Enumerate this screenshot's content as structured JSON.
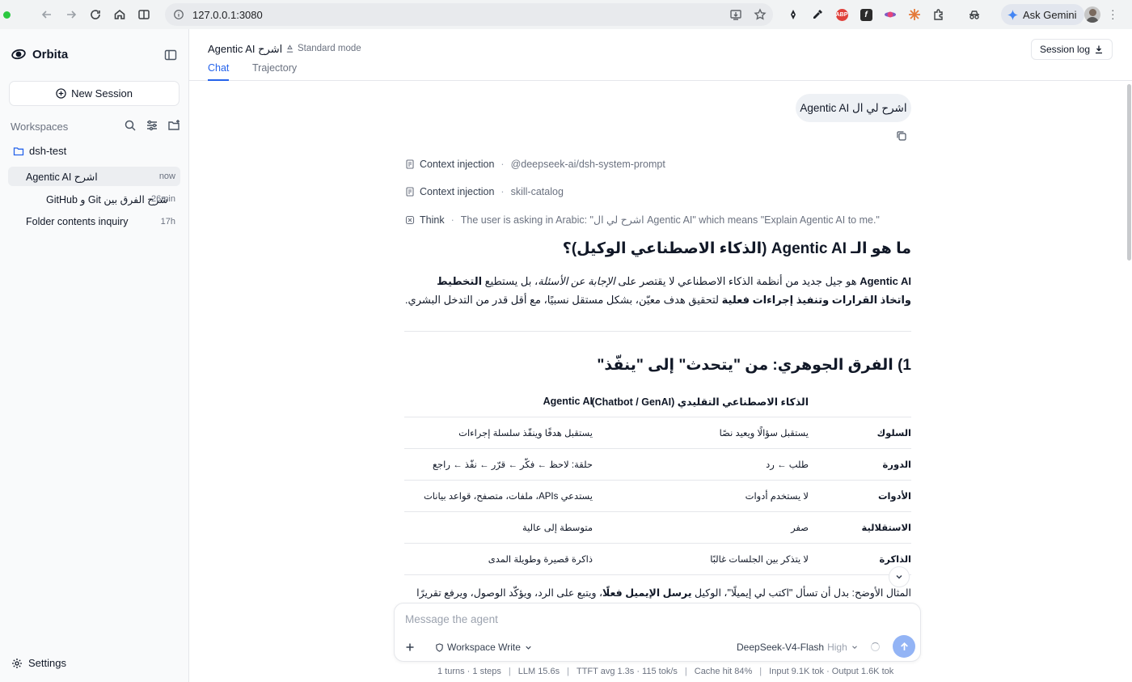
{
  "browser": {
    "url": "127.0.0.1:3080",
    "gemini_label": "Ask Gemini",
    "extensions": [
      "pen-icon",
      "eyedropper-icon",
      "adblock-icon",
      "font-icon",
      "planet-icon",
      "sparkle-icon",
      "puzzle-icon",
      "incognito-icon"
    ]
  },
  "sidebar": {
    "brand": "Orbita",
    "new_session": "New Session",
    "workspaces_title": "Workspaces",
    "folder": "dsh-test",
    "sessions": [
      {
        "title": "اشرح Agentic AI",
        "time": "now",
        "active": true
      },
      {
        "title": "شرح الفرق بين Git و GitHub",
        "time": "26min",
        "active": false
      },
      {
        "title": "Folder contents inquiry",
        "time": "17h",
        "active": false
      }
    ],
    "settings": "Settings"
  },
  "header": {
    "title": "اشرح Agentic AI",
    "mode": "Standard mode",
    "tabs": [
      {
        "label": "Chat",
        "active": true
      },
      {
        "label": "Trajectory",
        "active": false
      }
    ],
    "session_log": "Session log"
  },
  "chat": {
    "user_message": "اشرح لي ال Agentic AI",
    "steps": [
      {
        "kind": "Context injection",
        "detail": "@deepseek-ai/dsh-system-prompt"
      },
      {
        "kind": "Context injection",
        "detail": "skill-catalog"
      },
      {
        "kind": "Think",
        "detail": "The user is asking in Arabic: \"اشرح لي ال Agentic AI\" which means \"Explain Agentic AI to me.\""
      }
    ],
    "answer": {
      "heading1": "ما هو الـ Agentic AI (الذكاء الاصطناعي الوكيل)؟",
      "intro_term": "Agentic AI",
      "intro_a": " هو جيل جديد من أنظمة الذكاء الاصطناعي لا يقتصر على ",
      "intro_em": "الإجابة عن الأسئلة",
      "intro_b": "، بل يستطيع ",
      "intro_strong1": "التخطيط واتخاذ القرارات وتنفيذ إجراءات فعلية",
      "intro_c": " لتحقيق هدف معيّن، بشكل مستقل نسبيًا، مع أقل قدر من التدخل البشري.",
      "heading2": "1) الفرق الجوهري: من \"يتحدث\" إلى \"ينفّذ\"",
      "table_headers": [
        "",
        "الذكاء الاصطناعي التقليدي (Chatbot / GenAI)",
        "Agentic AI"
      ],
      "table_rows": [
        [
          "السلوك",
          "يستقبل سؤالًا ويعيد نصًا",
          "يستقبل هدفًا وينفّذ سلسلة إجراءات"
        ],
        [
          "الدورة",
          "طلب ← رد",
          "حلقة: لاحظ ← فكّر ← قرّر ← نفّذ ← راجع"
        ],
        [
          "الأدوات",
          "لا يستخدم أدوات",
          "يستدعي APIs، ملفات، متصفح، قواعد بيانات"
        ],
        [
          "الاستقلالية",
          "صفر",
          "متوسطة إلى عالية"
        ],
        [
          "الذاكرة",
          "لا يتذكر بين الجلسات غالبًا",
          "ذاكرة قصيرة وطويلة المدى"
        ]
      ],
      "example_a": "المثال الأوضح: بدل أن تسأل \"اكتب لي إيميلًا\"، الوكيل ",
      "example_strong": "يرسل الإيميل فعلًا",
      "example_b": "، ويتبع على الرد، ويؤكّد الوصول، ويرفع تقريرًا لك في النهاية."
    }
  },
  "composer": {
    "placeholder": "Message the agent",
    "permission": "Workspace Write",
    "model": "DeepSeek-V4-Flash",
    "effort": "High"
  },
  "stats": [
    "1 turns · 1 steps",
    "LLM 15.6s",
    "TTFT avg 1.3s · 115 tok/s",
    "Cache hit 84%",
    "Input 9.1K tok · Output 1.6K tok"
  ]
}
